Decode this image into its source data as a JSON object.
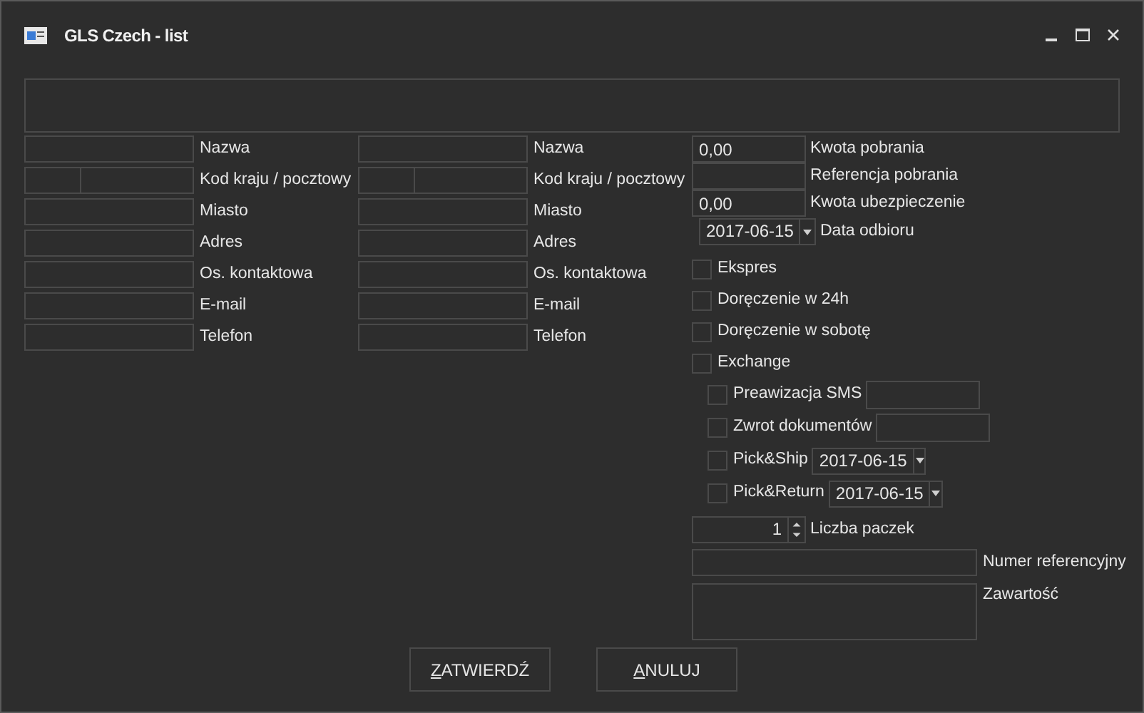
{
  "window": {
    "title": "GLS Czech - list"
  },
  "sender": {
    "fields": [
      {
        "label": "Nazwa",
        "kind": "text"
      },
      {
        "label": "Kod kraju / pocztowy",
        "kind": "split"
      },
      {
        "label": "Miasto",
        "kind": "text"
      },
      {
        "label": "Adres",
        "kind": "text"
      },
      {
        "label": "Os. kontaktowa",
        "kind": "text"
      },
      {
        "label": "E-mail",
        "kind": "text"
      },
      {
        "label": "Telefon",
        "kind": "text"
      }
    ]
  },
  "recipient": {
    "fields": [
      {
        "label": "Nazwa",
        "kind": "text"
      },
      {
        "label": "Kod kraju / pocztowy",
        "kind": "split"
      },
      {
        "label": "Miasto",
        "kind": "text"
      },
      {
        "label": "Adres",
        "kind": "text"
      },
      {
        "label": "Os. kontaktowa",
        "kind": "text"
      },
      {
        "label": "E-mail",
        "kind": "text"
      },
      {
        "label": "Telefon",
        "kind": "text"
      }
    ]
  },
  "payment": {
    "fields": [
      {
        "label": "Kwota pobrania",
        "value": "0,00"
      },
      {
        "label": "Referencja pobrania"
      },
      {
        "label": "Kwota ubezpieczenie",
        "value": "0,00"
      }
    ],
    "pickup_date": {
      "value": "2017-06-15",
      "label": "Data odbioru"
    }
  },
  "services": [
    {
      "label": "Ekspres",
      "checked": false
    },
    {
      "label": "Doręczenie w 24h",
      "checked": false
    },
    {
      "label": "Doręczenie w sobotę",
      "checked": false
    },
    {
      "label": "Exchange",
      "checked": false
    }
  ],
  "options": [
    {
      "label": "Preawizacja SMS",
      "checked": false,
      "kind": "text"
    },
    {
      "label": "Zwrot dokumentów",
      "checked": false,
      "kind": "text"
    },
    {
      "label": "Pick&Ship",
      "checked": false,
      "kind": "date",
      "value": "2017-06-15"
    },
    {
      "label": "Pick&Return",
      "checked": false,
      "kind": "date",
      "value": "2017-06-15"
    }
  ],
  "parcel_count": {
    "value": "1",
    "label": "Liczba paczek"
  },
  "reference": {
    "label": "Numer referencyjny"
  },
  "contents": {
    "label": "Zawartość"
  },
  "buttons": [
    {
      "label": "ZATWIERDŹ"
    },
    {
      "label": "ANULUJ"
    }
  ]
}
